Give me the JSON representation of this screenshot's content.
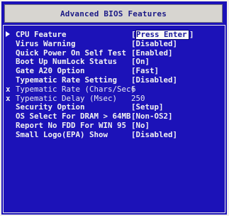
{
  "screen": {
    "title": "Advanced BIOS Features"
  },
  "items": [
    {
      "prefix": "arrow",
      "label": "CPU Feature",
      "value_open": "[",
      "value": "Press Enter",
      "value_close": "]",
      "selected": true,
      "disabled": false
    },
    {
      "prefix": "",
      "label": "Virus Warning",
      "value": "[Disabled]",
      "selected": false,
      "disabled": false
    },
    {
      "prefix": "",
      "label": "Quick Power On Self Test",
      "value": "[Enabled]",
      "selected": false,
      "disabled": false
    },
    {
      "prefix": "",
      "label": "Boot Up NumLock Status",
      "value": "[On]",
      "selected": false,
      "disabled": false
    },
    {
      "prefix": "",
      "label": "Gate A20 Option",
      "value": "[Fast]",
      "selected": false,
      "disabled": false
    },
    {
      "prefix": "",
      "label": "Typematic Rate Setting",
      "value": "[Disabled]",
      "selected": false,
      "disabled": false
    },
    {
      "prefix": "x",
      "label": "Typematic Rate (Chars/Sec)",
      "value": "6",
      "selected": false,
      "disabled": true
    },
    {
      "prefix": "x",
      "label": "Typematic Delay (Msec)",
      "value": "250",
      "selected": false,
      "disabled": true
    },
    {
      "prefix": "",
      "label": "Security Option",
      "value": "[Setup]",
      "selected": false,
      "disabled": false
    },
    {
      "prefix": "",
      "label": "OS Select For DRAM > 64MB",
      "value": "[Non-OS2]",
      "selected": false,
      "disabled": false
    },
    {
      "prefix": "",
      "label": "Report No FDD For WIN 95",
      "value": "[No]",
      "selected": false,
      "disabled": false
    },
    {
      "prefix": "",
      "label": "Small Logo(EPA) Show",
      "value": "[Disabled]",
      "selected": false,
      "disabled": false
    }
  ],
  "colors": {
    "background": "#1c12b8",
    "header_background": "#d7d5d0",
    "header_text": "#1b1a86",
    "text": "#f2f2f2",
    "selected_background": "#f7f7f7",
    "selected_text": "#17179b"
  }
}
